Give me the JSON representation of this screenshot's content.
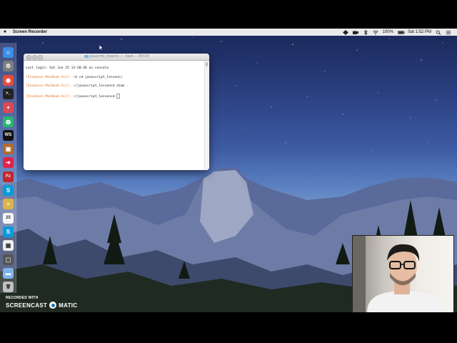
{
  "menubar": {
    "app_name": "Screen Recorder",
    "battery": "100%",
    "clock": "Sat 1:52 PM"
  },
  "terminal": {
    "title": "javascript_lessons — -bash — 80×24",
    "lines": [
      {
        "prompt": "",
        "text": "Last login: Sat Jun 25 13:30:46 on console"
      },
      {
        "prompt": "[Stephens-MacBook-Air]:",
        "text": " ~$ cd javascript_lessons/"
      },
      {
        "prompt": "[Stephens-MacBook-Air]:",
        "text": " ~/javascript_lessons$ atom ."
      },
      {
        "prompt": "[Stephens-MacBook-Air]:",
        "text": " ~/javascript_lessons$ "
      }
    ]
  },
  "dock": {
    "items": [
      {
        "icon": "finder-icon",
        "color": "#3a8ee6"
      },
      {
        "icon": "system-preferences-icon",
        "color": "#7d7d7d"
      },
      {
        "icon": "chrome-icon",
        "color": "#e84b3c"
      },
      {
        "icon": "terminal-icon",
        "color": "#222222"
      },
      {
        "icon": "plus-app-icon",
        "color": "#d94a55"
      },
      {
        "icon": "globe-app-icon",
        "color": "#2bb673"
      },
      {
        "icon": "webstorm-icon",
        "color": "#111111"
      },
      {
        "icon": "archive-icon",
        "color": "#b56a2a"
      },
      {
        "icon": "arrow-app-icon",
        "color": "#e0244a"
      },
      {
        "icon": "filezilla-icon",
        "color": "#c1272d"
      },
      {
        "icon": "skype-icon",
        "color": "#0a9bdb"
      },
      {
        "icon": "notes-icon",
        "color": "#d9b44a"
      },
      {
        "icon": "calendar-icon",
        "color": "#f5f5f5"
      },
      {
        "icon": "skype-alt-icon",
        "color": "#0a9bdb"
      },
      {
        "icon": "launchpad-icon",
        "color": "#eeeeee"
      },
      {
        "icon": "screenshot-icon",
        "color": "#555555"
      },
      {
        "icon": "folder-icon",
        "color": "#7db4e8"
      },
      {
        "icon": "trash-icon",
        "color": "#bfbfbf"
      }
    ]
  },
  "watermark": {
    "line1": "RECORDED WITH",
    "brand_left": "SCREENCAST",
    "brand_right": "MATIC"
  }
}
